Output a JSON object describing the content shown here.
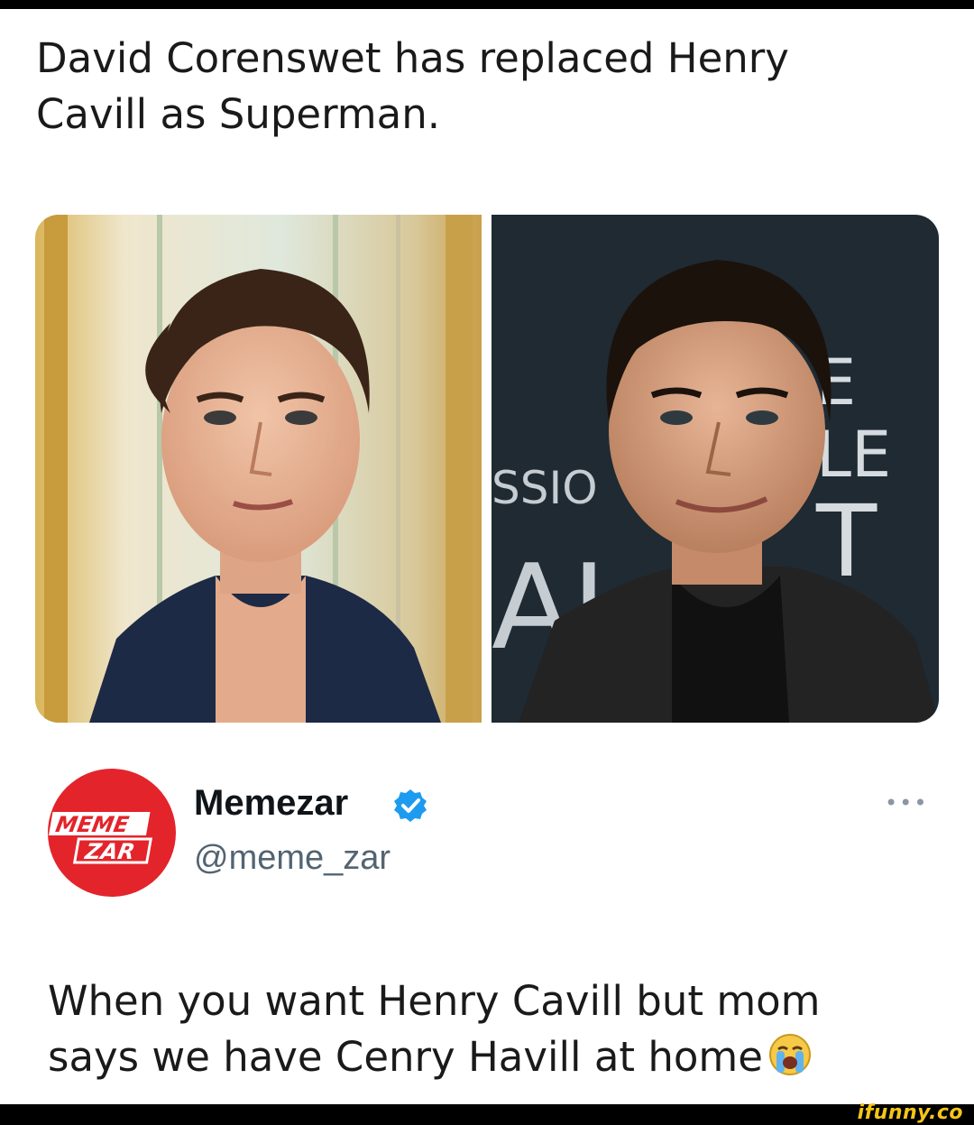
{
  "post": {
    "headline": "David Corenswet has replaced Henry Cavill as Superman."
  },
  "tweet": {
    "author_name": "Memezar",
    "handle": "@meme_zar",
    "verified": true,
    "text": "When you want Henry Cavill but mom says we have Cenry Havill at home",
    "emoji": "loudly-crying-face-icon"
  },
  "avatar": {
    "line1": "MEME",
    "line2": "ZAR",
    "color": "#e3242b"
  },
  "backdrop_text": {
    "right_top": "E",
    "right_mid": "LE",
    "right_low": "T",
    "left_mid": "SSIO",
    "left_low": "AI"
  },
  "watermark": "ifunny.co",
  "colors": {
    "verified": "#1d9bf0",
    "handle": "#536471",
    "watermark": "#f5c518"
  }
}
